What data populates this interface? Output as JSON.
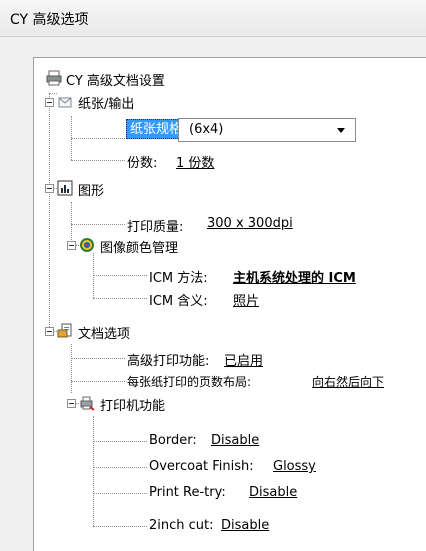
{
  "window": {
    "title": "CY 高级选项"
  },
  "tree": {
    "root": {
      "label": "CY 高级文档设置",
      "icon": "printer-icon"
    },
    "paper_output": {
      "label": "纸张/输出",
      "icon": "paper-output-icon",
      "paper_size": {
        "label": "纸张规格:",
        "value": "(6x4)"
      },
      "copies": {
        "label": "份数:",
        "value": "1 份数"
      }
    },
    "graphics": {
      "label": "图形",
      "icon": "graphics-icon",
      "print_quality": {
        "label": "打印质量:",
        "value": "300 x 300dpi"
      },
      "color_management": {
        "label": "图像颜色管理",
        "icon": "color-target-icon",
        "icm_method": {
          "label": "ICM 方法:",
          "value": "主机系统处理的 ICM"
        },
        "icm_intent": {
          "label": "ICM 含义:",
          "value": "照片"
        }
      }
    },
    "document_options": {
      "label": "文档选项",
      "icon": "document-options-icon",
      "advanced_printing": {
        "label": "高级打印功能:",
        "value": "已启用"
      },
      "pages_per_sheet_layout": {
        "label": "每张纸打印的页数布局:",
        "value": "向右然后向下"
      },
      "printer_features": {
        "label": "打印机功能",
        "icon": "printer-features-icon",
        "border": {
          "label": "Border:",
          "value": "Disable"
        },
        "overcoat": {
          "label": "Overcoat Finish:",
          "value": "Glossy"
        },
        "retry": {
          "label": "Print Re-try:",
          "value": "Disable"
        },
        "cut": {
          "label": "2inch cut:",
          "value": "Disable"
        }
      }
    }
  }
}
